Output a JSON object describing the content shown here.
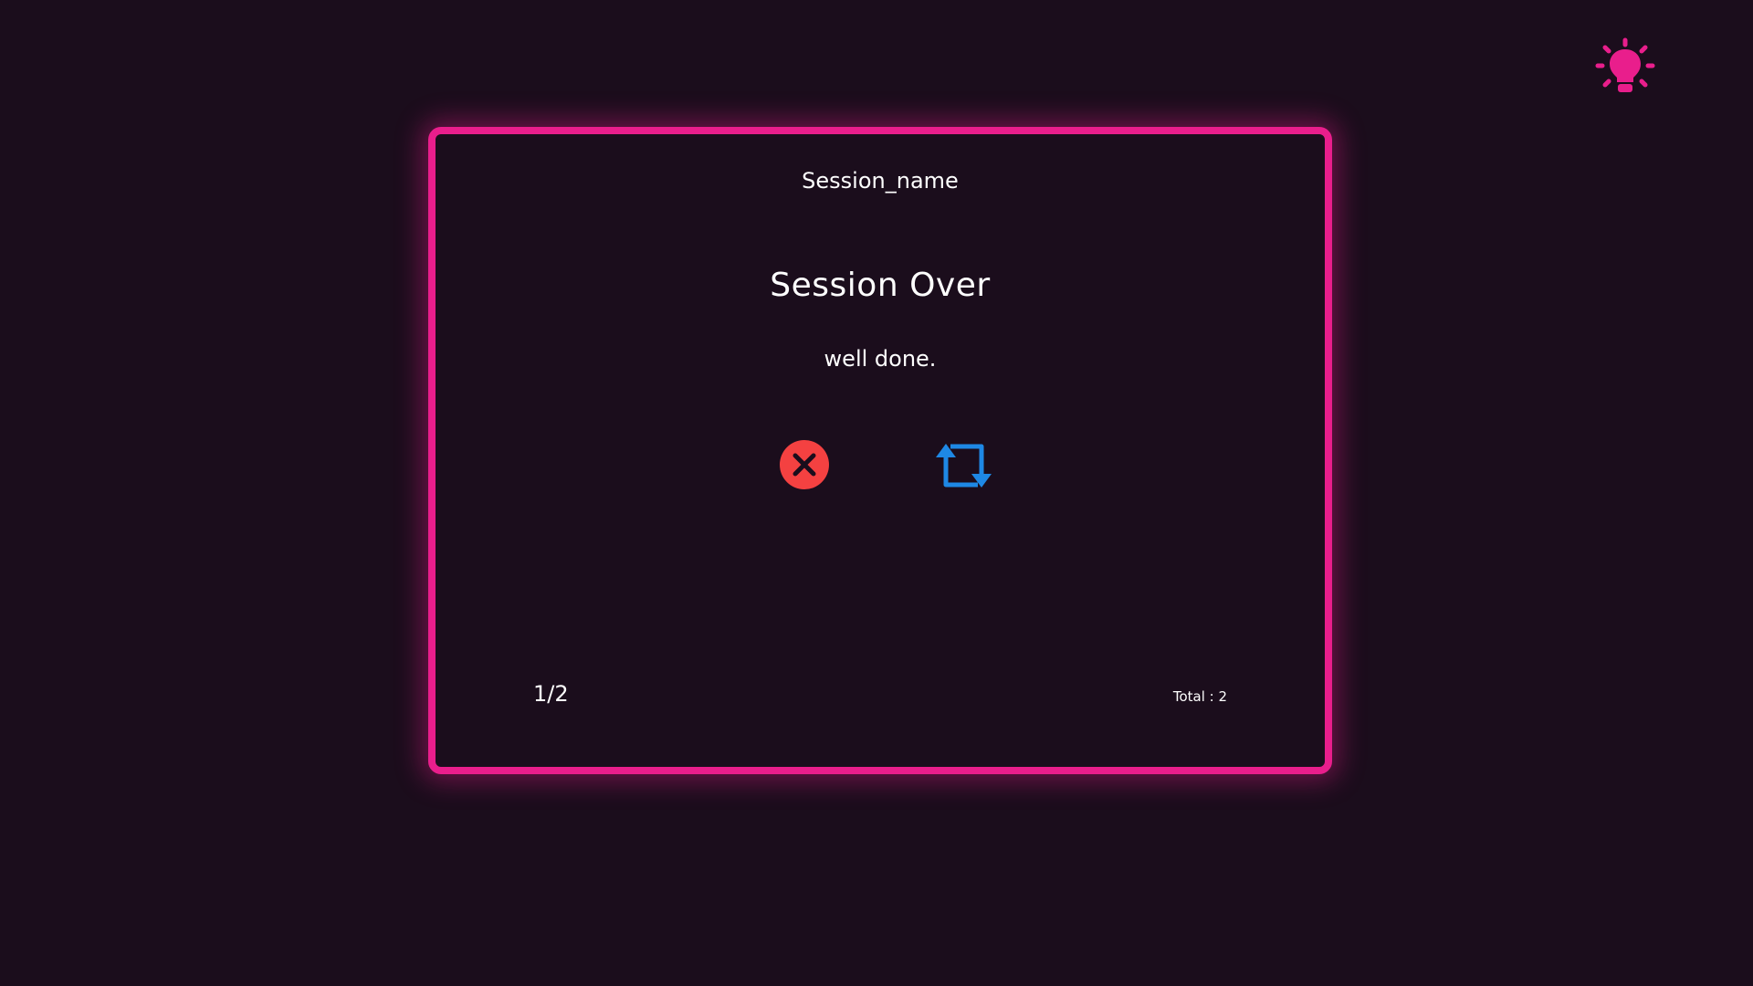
{
  "header": {
    "theme_toggle_icon": "lightbulb-icon",
    "accent_color": "#e91e8c"
  },
  "card": {
    "session_name": "Session_name",
    "title": "Session Over",
    "message": "well done.",
    "actions": {
      "close_icon": "close-circle-icon",
      "close_color": "#f44141",
      "repeat_icon": "repeat-icon",
      "repeat_color": "#1e88e5"
    },
    "progress": "1/2",
    "total": "Total : 2"
  }
}
